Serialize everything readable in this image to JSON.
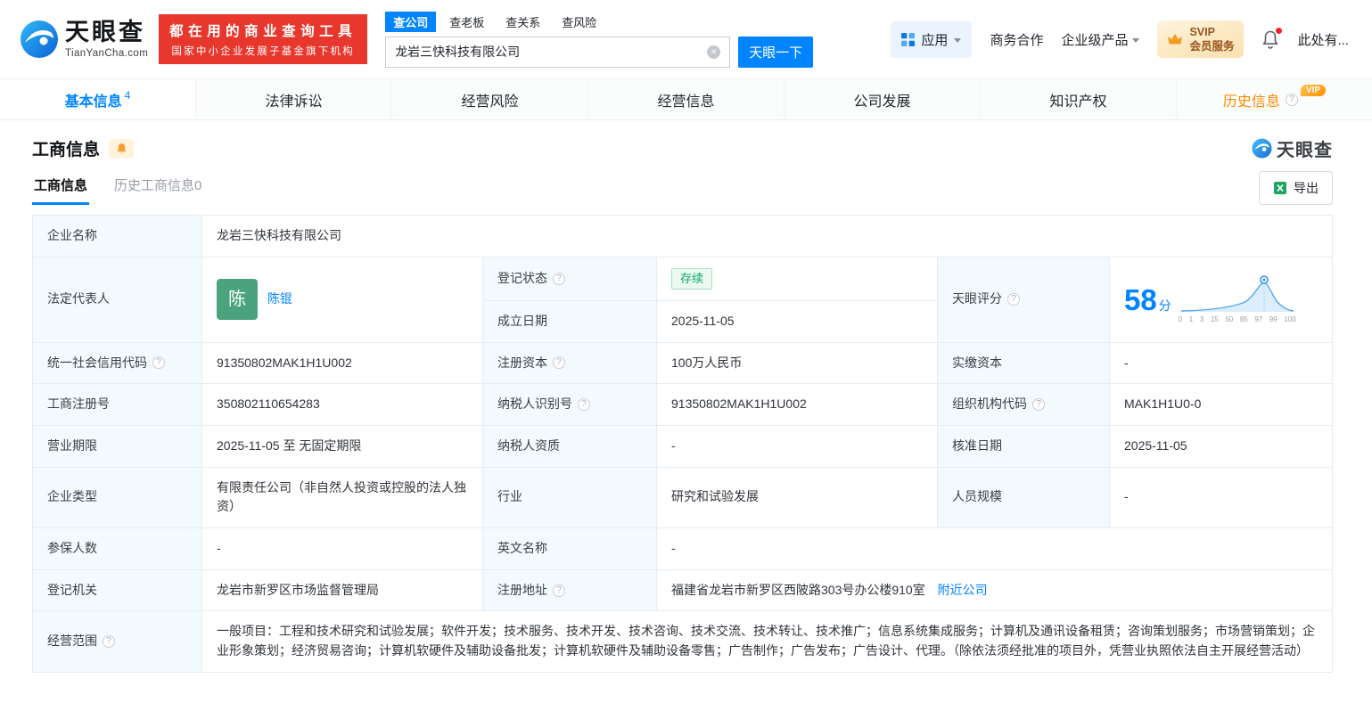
{
  "header": {
    "brand": "天眼查",
    "brand_domain": "TianYanCha.com",
    "slogan_line1": "都在用的商业查询工具",
    "slogan_line2": "国家中小企业发展子基金旗下机构",
    "search_tabs": [
      {
        "label": "查公司"
      },
      {
        "label": "查老板"
      },
      {
        "label": "查关系"
      },
      {
        "label": "查风险"
      }
    ],
    "search_value": "龙岩三快科技有限公司",
    "search_button": "天眼一下",
    "nav": {
      "app": "应用",
      "cooperation": "商务合作",
      "enterprise": "企业级产品",
      "svip_line1": "SVIP",
      "svip_line2": "会员服务",
      "more": "此处有..."
    }
  },
  "main_tabs": [
    {
      "label": "基本信息",
      "count": "4"
    },
    {
      "label": "法律诉讼"
    },
    {
      "label": "经营风险"
    },
    {
      "label": "经营信息"
    },
    {
      "label": "公司发展"
    },
    {
      "label": "知识产权"
    },
    {
      "label": "历史信息",
      "badge": "VIP"
    }
  ],
  "section": {
    "title": "工商信息",
    "watermark": "天眼查",
    "subtabs": [
      {
        "label": "工商信息"
      },
      {
        "label": "历史工商信息0"
      }
    ],
    "export_label": "导出"
  },
  "fields": {
    "company_name": {
      "label": "企业名称",
      "value": "龙岩三快科技有限公司"
    },
    "legal_rep": {
      "label": "法定代表人",
      "avatar": "陈",
      "value": "陈锟"
    },
    "reg_status": {
      "label": "登记状态",
      "value": "存续"
    },
    "establish_date": {
      "label": "成立日期",
      "value": "2025-11-05"
    },
    "tyc_score": {
      "label": "天眼评分",
      "score": "58",
      "unit": "分"
    },
    "credit_code": {
      "label": "统一社会信用代码",
      "value": "91350802MAK1H1U002"
    },
    "reg_capital": {
      "label": "注册资本",
      "value": "100万人民币"
    },
    "paid_capital": {
      "label": "实缴资本",
      "value": "-"
    },
    "reg_number": {
      "label": "工商注册号",
      "value": "350802110654283"
    },
    "taxpayer_id": {
      "label": "纳税人识别号",
      "value": "91350802MAK1H1U002"
    },
    "org_code": {
      "label": "组织机构代码",
      "value": "MAK1H1U0-0"
    },
    "business_term": {
      "label": "营业期限",
      "value": "2025-11-05 至 无固定期限"
    },
    "taxpayer_quality": {
      "label": "纳税人资质",
      "value": "-"
    },
    "approval_date": {
      "label": "核准日期",
      "value": "2025-11-05"
    },
    "company_type": {
      "label": "企业类型",
      "value": "有限责任公司（非自然人投资或控股的法人独资）"
    },
    "industry": {
      "label": "行业",
      "value": "研究和试验发展"
    },
    "staff_size": {
      "label": "人员规模",
      "value": "-"
    },
    "insured_num": {
      "label": "参保人数",
      "value": "-"
    },
    "english_name": {
      "label": "英文名称",
      "value": "-"
    },
    "reg_authority": {
      "label": "登记机关",
      "value": "龙岩市新罗区市场监督管理局"
    },
    "reg_address": {
      "label": "注册地址",
      "value": "福建省龙岩市新罗区西陂路303号办公楼910室",
      "link": "附近公司"
    },
    "business_scope": {
      "label": "经营范围",
      "value": "一般项目：工程和技术研究和试验发展；软件开发；技术服务、技术开发、技术咨询、技术交流、技术转让、技术推广；信息系统集成服务；计算机及通讯设备租赁；咨询策划服务；市场营销策划；企业形象策划；经济贸易咨询；计算机软硬件及辅助设备批发；计算机软硬件及辅助设备零售；广告制作；广告发布；广告设计、代理。（除依法须经批准的项目外，凭营业执照依法自主开展经营活动）"
    }
  },
  "score_chart": {
    "type": "area",
    "marker_score": 58,
    "x_ticks": [
      "0",
      "1",
      "3",
      "15",
      "50",
      "85",
      "97",
      "99",
      "100"
    ]
  },
  "colors": {
    "brand_blue": "#0084ff",
    "banner_red": "#e8372c",
    "status_green": "#0ca864",
    "vip_orange": "#ff8a00",
    "label_cell_bg": "#f3fafd"
  }
}
